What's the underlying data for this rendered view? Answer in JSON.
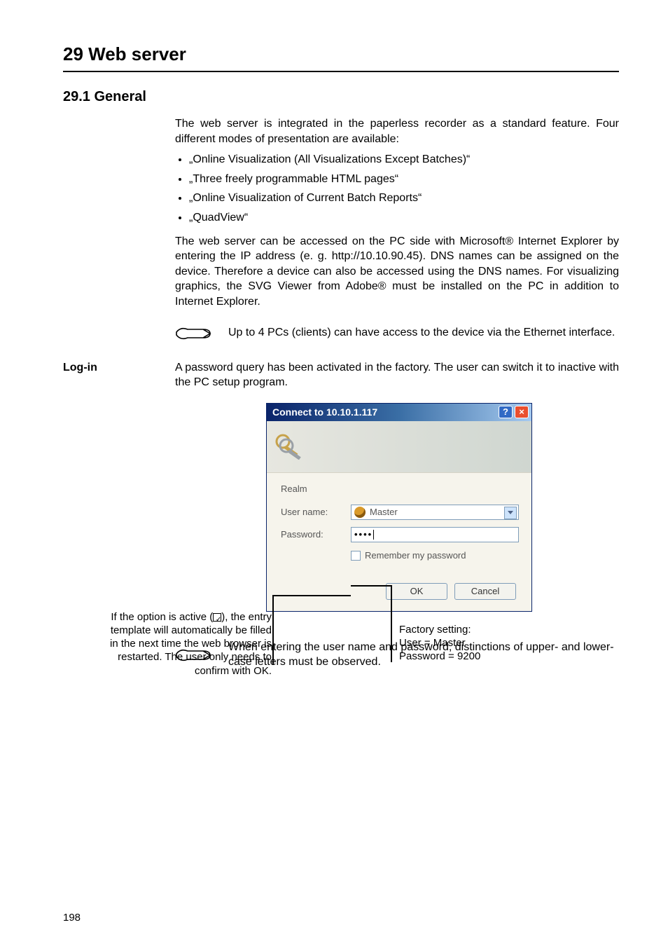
{
  "chapter": "29 Web server",
  "section": "29.1   General",
  "p1": "The web server is integrated in the paperless recorder as a standard feature. Four different modes of presentation are available:",
  "bullets": [
    "„Online Visualization (All Visualizations Except Batches)“",
    "„Three freely programmable HTML pages“",
    "„Online Visualization of Current Batch Reports“",
    "„QuadView“"
  ],
  "p2": "The web server can be accessed on the PC side with Microsoft® Internet Explorer by entering the IP address (e. g. http://10.10.90.45).  DNS names can be assigned on the device. Therefore a device can also be accessed using the DNS names. For visualizing graphics, the SVG Viewer from Adobe® must be installed on the PC in addition to Internet Explorer.",
  "note1": "Up to 4 PCs (clients) can have access to the device via the Ethernet interface.",
  "login_head": "Log-in",
  "login_text": "A password query has been activated in the factory. The user can switch it to inactive with the PC setup program.",
  "dialog": {
    "title": "Connect to 10.10.1.117",
    "realm": "Realm",
    "user_label": "User name:",
    "user_value": "Master",
    "pwd_label": "Password:",
    "pwd_value": "••••",
    "remember": "Remember my password",
    "ok": "OK",
    "cancel": "Cancel"
  },
  "callout_left_1": "If the option is active (",
  "callout_left_2": "), the entry template will automatically be filled in the next time the web browser is restarted. The user only needs to confirm with OK.",
  "callout_right_1": "Factory setting:",
  "callout_right_2": "User = Master",
  "callout_right_3": "Password = 9200",
  "note2": "When entering the user name and password, distinctions of upper- and lower-case letters must be observed.",
  "page": "198"
}
